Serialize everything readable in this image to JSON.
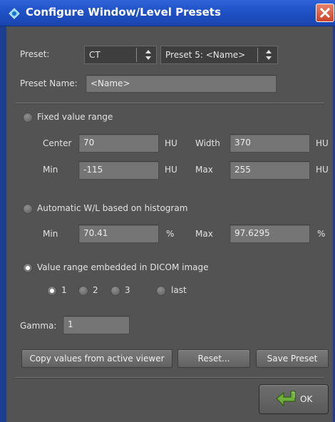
{
  "window": {
    "title": "Configure Window/Level Presets"
  },
  "preset": {
    "label": "Preset:",
    "modality_value": "CT",
    "preset_value": "Preset 5: <Name>",
    "name_label": "Preset Name:",
    "name_value": "<Name>"
  },
  "fixed": {
    "label": "Fixed value range",
    "selected": false,
    "center_label": "Center",
    "center_value": "70",
    "center_unit": "HU",
    "width_label": "Width",
    "width_value": "370",
    "width_unit": "HU",
    "min_label": "Min",
    "min_value": "-115",
    "min_unit": "HU",
    "max_label": "Max",
    "max_value": "255",
    "max_unit": "HU"
  },
  "auto": {
    "label": "Automatic W/L based on histogram",
    "selected": false,
    "min_label": "Min",
    "min_value": "70.41",
    "min_unit": "%",
    "max_label": "Max",
    "max_value": "97.6295",
    "max_unit": "%"
  },
  "dicom": {
    "label": "Value range embedded in DICOM image",
    "selected": true,
    "options": [
      {
        "label": "1",
        "selected": true
      },
      {
        "label": "2",
        "selected": false
      },
      {
        "label": "3",
        "selected": false
      },
      {
        "label": "last",
        "selected": false
      }
    ]
  },
  "gamma": {
    "label": "Gamma:",
    "value": "1"
  },
  "buttons": {
    "copy": "Copy values from active viewer",
    "reset": "Reset...",
    "save": "Save Preset",
    "ok": "OK"
  }
}
